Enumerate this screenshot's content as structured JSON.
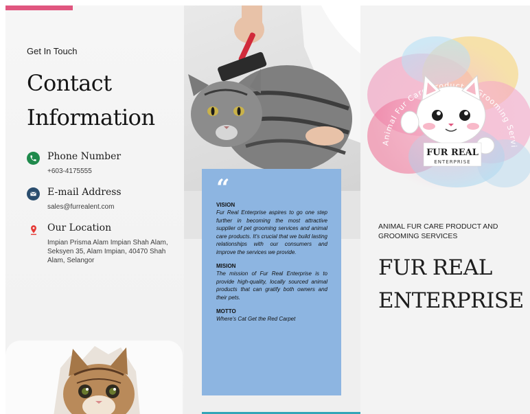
{
  "left": {
    "get_in_touch": "Get In Touch",
    "title_line1": "Contact",
    "title_line2": "Information",
    "phone": {
      "label": "Phone Number",
      "value": "+603-4175555"
    },
    "email": {
      "label": "E-mail Address",
      "value": "sales@furrealent.com"
    },
    "location": {
      "label": "Our Location",
      "value": "Impian Prisma Alam Impian Shah Alam, Seksyen 35, Alam Impian, 40470 Shah Alam, Selangor"
    }
  },
  "middle": {
    "quote_mark": "“",
    "vision_heading": "VISION",
    "vision_text": "Fur Real Enterprise aspires to go one step further in becoming the most attractive supplier of pet grooming services and animal care products. It's crucial that we build lasting relationships with our consumers and improve the services we provide.",
    "mission_heading": "MISION",
    "mission_text": "The mission of Fur Real Enterprise is to provide high-quality, locally sourced animal products that can gratify both owners and their pets.",
    "motto_heading": "MOTTO",
    "motto_text": "Where's Cat Get the Red Carpet"
  },
  "right": {
    "logo_arc_text": "Animal Fur Care Product & Grooming Services",
    "logo_name": "FUR REAL",
    "logo_sub": "ENTERPRISE",
    "tagline": "ANIMAL FUR CARE PRODUCT AND GROOMING SERVICES",
    "title_line1": "FUR REAL",
    "title_line2": "ENTERPRISE"
  },
  "colors": {
    "accent_pink": "#e0567f",
    "box_blue": "#8db5e1",
    "teal_line": "#33a5b7",
    "phone_icon": "#1f8a4c",
    "email_icon": "#2a4d6e",
    "location_icon": "#e53935"
  }
}
